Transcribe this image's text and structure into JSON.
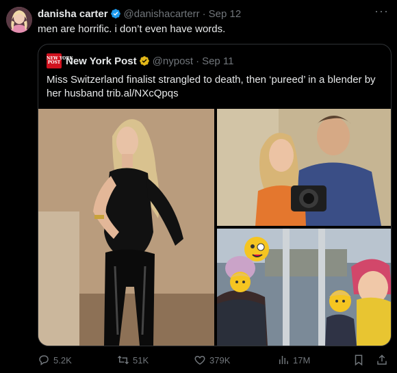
{
  "tweet": {
    "author_name": "danisha carter",
    "handle": "@danishacarterr",
    "separator": "·",
    "date": "Sep 12",
    "text": "men are horrific. i don’t even have words.",
    "more_label": "···"
  },
  "quote": {
    "author_name": "New York Post",
    "handle": "@nypost",
    "separator": "·",
    "date": "Sep 11",
    "logo_text_top": "NEW YORK",
    "logo_text_bottom": "POST",
    "text": "Miss Switzerland finalist strangled to death, then ‘pureed’ in a blender by her husband trib.al/NXcQpqs"
  },
  "actions": {
    "replies": "5.2K",
    "reposts": "51K",
    "likes": "379K",
    "views": "17M"
  },
  "colors": {
    "background": "#000000",
    "text": "#e7e9ea",
    "muted": "#71767b",
    "verified_blue": "#1d9bf0",
    "verified_gold": "#e2b719",
    "nyp_red": "#d1111e"
  },
  "icons": [
    "verified-badge-icon",
    "more-icon",
    "reply-icon",
    "repost-icon",
    "like-icon",
    "views-icon",
    "bookmark-icon",
    "share-icon"
  ]
}
